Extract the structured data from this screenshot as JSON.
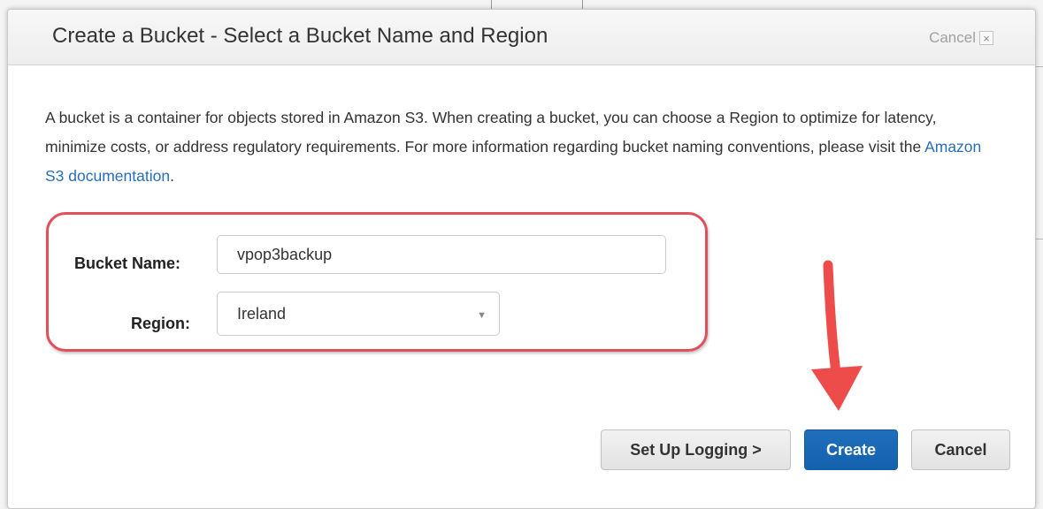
{
  "dialog": {
    "title": "Create a Bucket - Select a Bucket Name and Region",
    "header_cancel_label": "Cancel",
    "close_glyph": "×"
  },
  "description": {
    "text": "A bucket is a container for objects stored in Amazon S3. When creating a bucket, you can choose a Region to optimize for latency, minimize costs, or address regulatory requirements. For more information regarding bucket naming conventions, please visit the ",
    "link_text": "Amazon S3 documentation",
    "suffix": "."
  },
  "form": {
    "bucket_name_label": "Bucket Name:",
    "bucket_name_value": "vpop3backup",
    "region_label": "Region:",
    "region_value": "Ireland",
    "caret_glyph": "▼"
  },
  "buttons": {
    "setup_logging": "Set Up Logging >",
    "create": "Create",
    "cancel": "Cancel"
  },
  "colors": {
    "primary": "#1766b4",
    "link": "#2a6eb8",
    "highlight": "#e0505a",
    "arrow": "#ee4b4b"
  },
  "annotations": {
    "highlight_box": "red-rounded-rectangle",
    "arrow": "red-down-arrow"
  }
}
